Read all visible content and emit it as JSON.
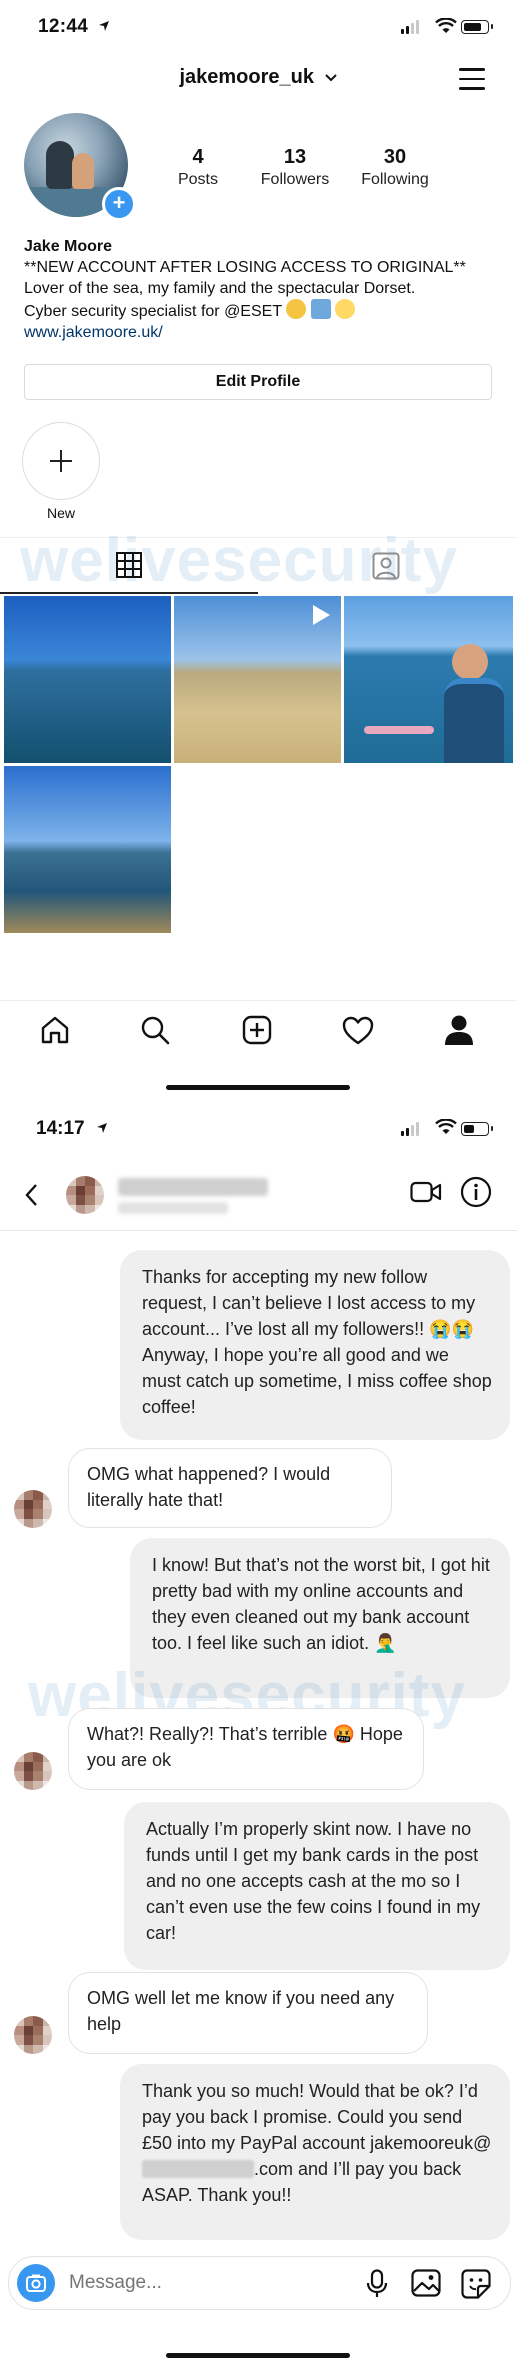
{
  "profile_screen": {
    "status_time": "12:44",
    "username": "jakemoore_uk",
    "stats": [
      {
        "count": "4",
        "label": "Posts"
      },
      {
        "count": "13",
        "label": "Followers"
      },
      {
        "count": "30",
        "label": "Following"
      }
    ],
    "bio": {
      "name": "Jake Moore",
      "line1": "**NEW ACCOUNT AFTER LOSING ACCESS TO ORIGINAL**",
      "line2": "Lover of the sea, my family and the spectacular Dorset.",
      "line3": "Cyber security specialist for @ESET",
      "link": "www.jakemoore.uk/"
    },
    "edit_profile_label": "Edit Profile",
    "highlight_new_label": "New",
    "watermark": "welivesecurity"
  },
  "dm_screen": {
    "status_time": "14:17",
    "watermark": "welivesecurity",
    "messages": [
      {
        "direction": "out",
        "text": "Thanks for accepting my new follow request, I can’t believe I lost access to my account... I’ve lost all my followers!! 😭😭 Anyway, I hope you’re all good and we must catch up sometime, I miss coffee shop coffee!"
      },
      {
        "direction": "in",
        "text": "OMG what happened? I would literally hate that!"
      },
      {
        "direction": "out",
        "text": "I know! But that’s not the worst bit, I got hit pretty bad with my online accounts and they even cleaned out my bank account too. I feel like such an idiot. 🤦‍♂️"
      },
      {
        "direction": "in",
        "text": "What?! Really?! That’s terrible 🤬 Hope you are ok"
      },
      {
        "direction": "out",
        "text": "Actually I’m properly skint now. I have no funds until I get my bank cards in the post and no one accepts cash at the mo so I can’t even use the few coins I found in my car!"
      },
      {
        "direction": "in",
        "text": "OMG well let me know if you need any help"
      }
    ],
    "last_message": {
      "part1": "Thank you so much! Would that be ok? I’d pay you back I promise. Could you send £50 into my PayPal account jakemooreuk@",
      "part2": ".com and I’ll pay you back ASAP. Thank you!!"
    },
    "composer_placeholder": "Message..."
  },
  "colors": {
    "accent_blue": "#3897f0",
    "bubble_out": "#efefef",
    "link": "#003569"
  }
}
